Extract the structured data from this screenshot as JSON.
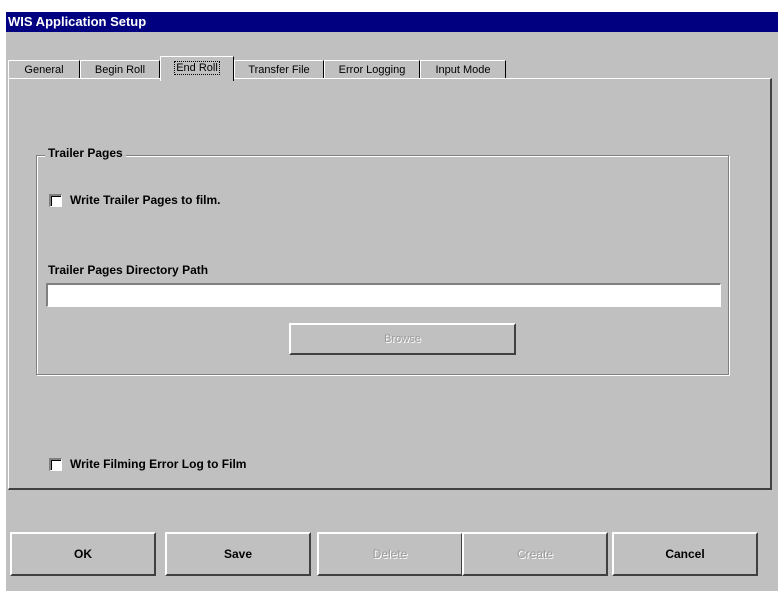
{
  "window": {
    "title": "WIS Application Setup"
  },
  "tabs": [
    {
      "label": "General",
      "active": false
    },
    {
      "label": "Begin Roll",
      "active": false
    },
    {
      "label": "End Roll",
      "active": true
    },
    {
      "label": "Transfer File",
      "active": false
    },
    {
      "label": "Error Logging",
      "active": false
    },
    {
      "label": "Input Mode",
      "active": false
    }
  ],
  "trailer_group": {
    "legend": "Trailer Pages",
    "write_checkbox_label": "Write Trailer Pages to film.",
    "write_checked": false,
    "path_label": "Trailer Pages Directory Path",
    "path_value": "",
    "browse_label": "Browse"
  },
  "error_log": {
    "checkbox_label": "Write Filming Error Log to Film",
    "checked": false
  },
  "buttons": {
    "ok": "OK",
    "save": "Save",
    "delete": "Delete",
    "create": "Create",
    "cancel": "Cancel"
  }
}
